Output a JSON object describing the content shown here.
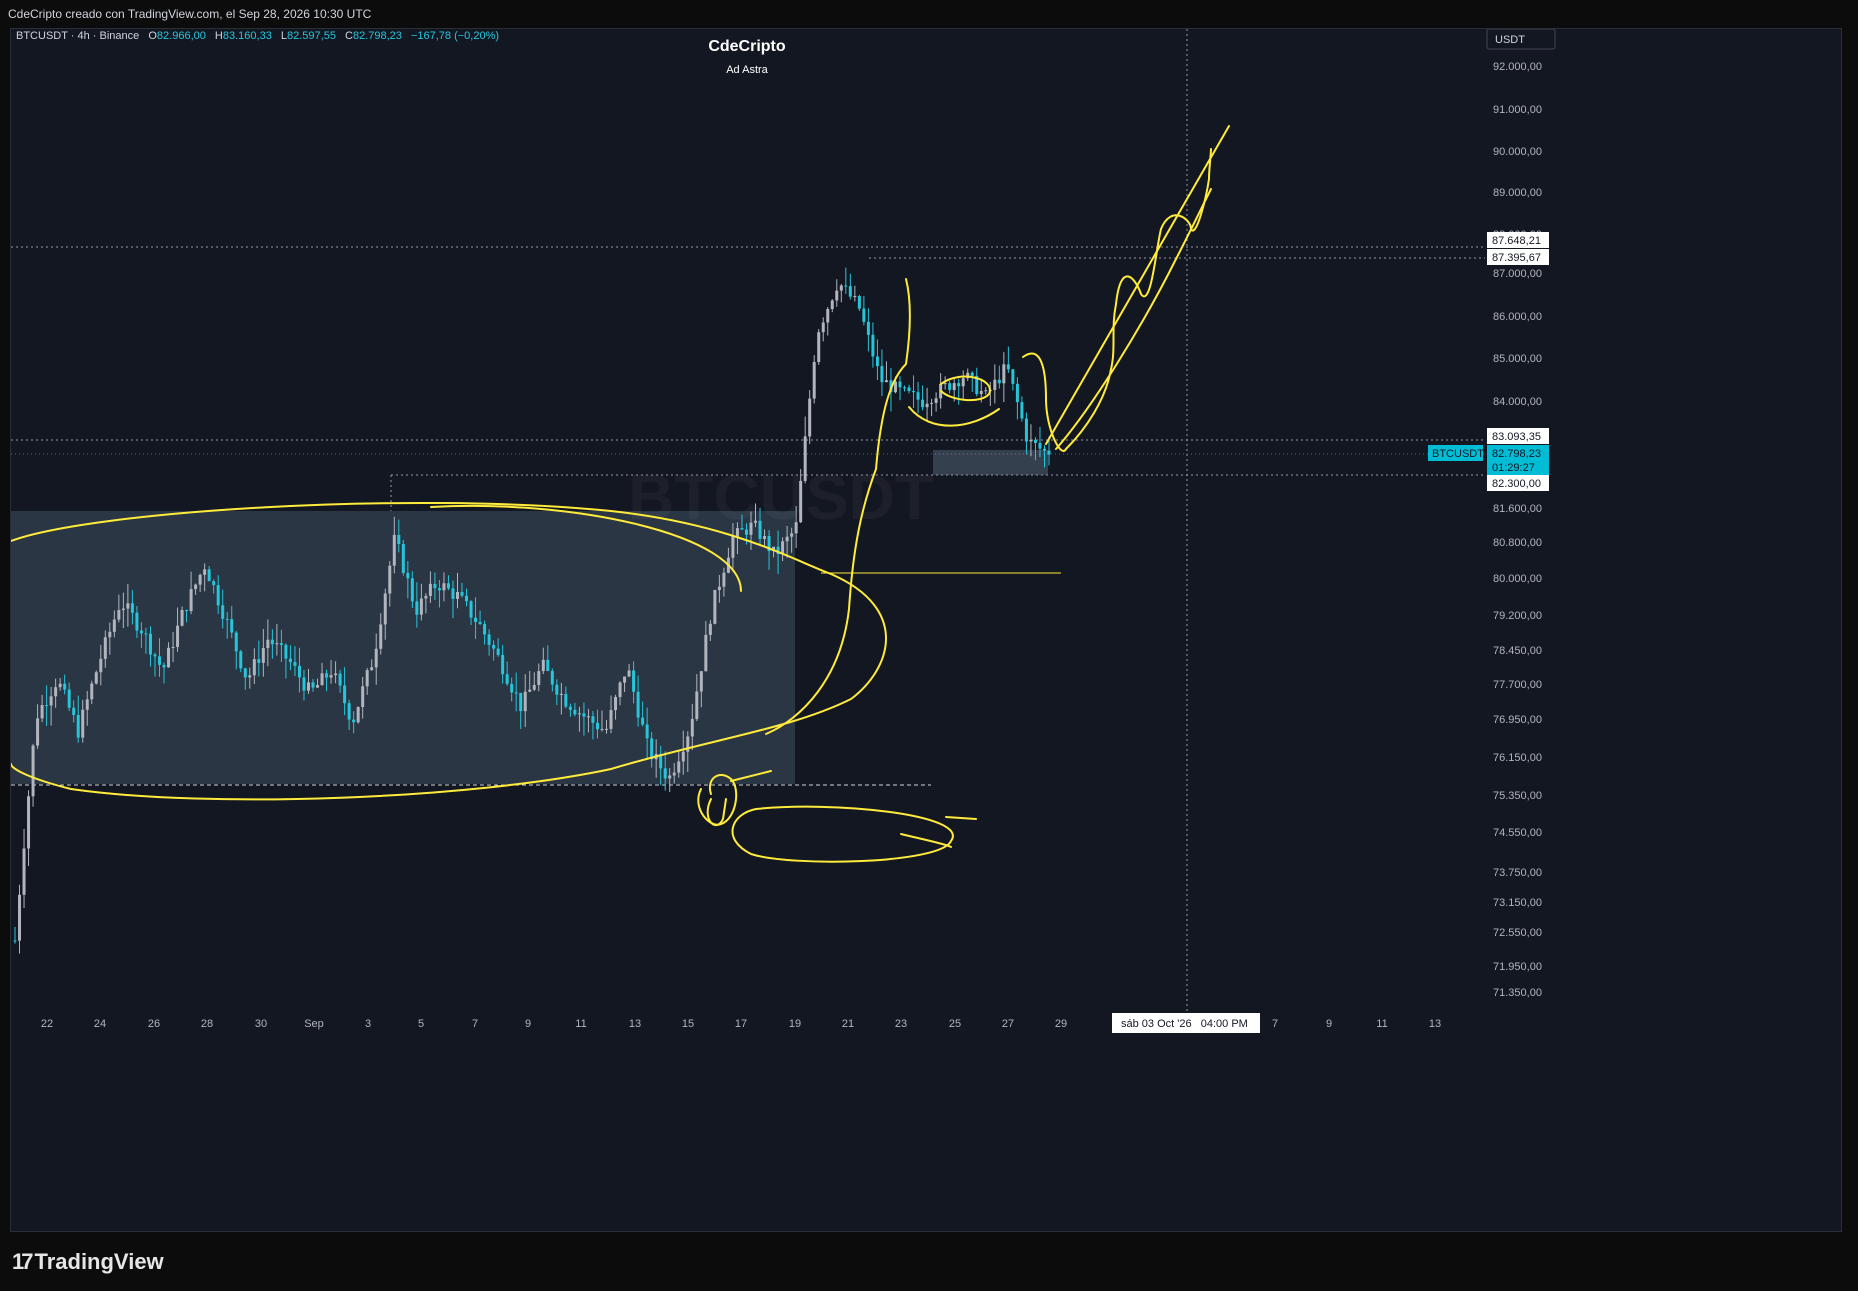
{
  "header": {
    "caption": "CdeCripto creado con TradingView.com, el Sep 28, 2026 10:30 UTC"
  },
  "symbol_info": {
    "label": "BTCUSDT · 4h · Binance",
    "o_label": "O",
    "o": "82.966,00",
    "h_label": "H",
    "h": "83.160,33",
    "l_label": "L",
    "l": "82.597,55",
    "c_label": "C",
    "c": "82.798,23",
    "change": "−167,78 (−0,20%)"
  },
  "chart_title": "CdeCripto",
  "chart_subtitle": "Ad Astra",
  "currency_button": "USDT",
  "watermark": "BTCUSDT",
  "price_labels": {
    "p1": "87.648,21",
    "p2": "87.395,67",
    "p3": "83.093,35",
    "p4": "82.798,23",
    "countdown": "01:29:27",
    "p5": "82.300,00",
    "ticker_tag": "BTCUSDT"
  },
  "crosshair_label": "sáb 03 Oct '26   04:00 PM",
  "brand": "TradingView",
  "colors": {
    "up": "#b2b5be",
    "down": "#26c6da",
    "annotation": "#ffeb3b",
    "background": "#131722",
    "last_price": "#00bcd4"
  },
  "chart_data": {
    "type": "candlestick",
    "symbol": "BTCUSDT",
    "interval": "4h",
    "exchange": "Binance",
    "y_axis": {
      "ticks": [
        {
          "v": 92000,
          "label": "92.000,00"
        },
        {
          "v": 91000,
          "label": "91.000,00"
        },
        {
          "v": 90000,
          "label": "90.000,00"
        },
        {
          "v": 89000,
          "label": "89.000,00"
        },
        {
          "v": 88000,
          "label": "88.000,00"
        },
        {
          "v": 87000,
          "label": "87.000,00"
        },
        {
          "v": 86000,
          "label": "86.000,00"
        },
        {
          "v": 85000,
          "label": "85.000,00"
        },
        {
          "v": 84000,
          "label": "84.000,00"
        },
        {
          "v": 81600,
          "label": "81.600,00"
        },
        {
          "v": 80800,
          "label": "80.800,00"
        },
        {
          "v": 80000,
          "label": "80.000,00"
        },
        {
          "v": 79200,
          "label": "79.200,00"
        },
        {
          "v": 78450,
          "label": "78.450,00"
        },
        {
          "v": 77700,
          "label": "77.700,00"
        },
        {
          "v": 76950,
          "label": "76.950,00"
        },
        {
          "v": 76150,
          "label": "76.150,00"
        },
        {
          "v": 75350,
          "label": "75.350,00"
        },
        {
          "v": 74550,
          "label": "74.550,00"
        },
        {
          "v": 73750,
          "label": "73.750,00"
        },
        {
          "v": 73150,
          "label": "73.150,00"
        },
        {
          "v": 72550,
          "label": "72.550,00"
        },
        {
          "v": 71950,
          "label": "71.950,00"
        },
        {
          "v": 71350,
          "label": "71.350,00"
        }
      ],
      "right_labels": [
        "87.648,21",
        "87.395,67",
        "83.093,35",
        "82.798,23",
        "82.300,00"
      ]
    },
    "x_axis": {
      "ticks": [
        "22",
        "24",
        "26",
        "28",
        "30",
        "Sep",
        "3",
        "5",
        "7",
        "9",
        "11",
        "13",
        "15",
        "17",
        "19",
        "21",
        "23",
        "25",
        "27",
        "29",
        "7",
        "9",
        "11",
        "13"
      ],
      "crosshair": "sáb 03 Oct '26   04:00 PM"
    },
    "ohlc_last": {
      "open": 82966.0,
      "high": 83160.33,
      "low": 82597.55,
      "close": 82798.23
    },
    "horizontal_levels": [
      87648.21,
      87395.67,
      83093.35,
      82300.0,
      80100,
      75550
    ],
    "price_path": [
      [
        0,
        72400
      ],
      [
        1,
        77000
      ],
      [
        2,
        77800
      ],
      [
        3,
        76700
      ],
      [
        4,
        78200
      ],
      [
        5,
        79500
      ],
      [
        6,
        78900
      ],
      [
        7,
        78000
      ],
      [
        8,
        79300
      ],
      [
        9,
        80300
      ],
      [
        10,
        79100
      ],
      [
        11,
        77800
      ],
      [
        12,
        78700
      ],
      [
        13,
        78200
      ],
      [
        14,
        77500
      ],
      [
        15,
        78000
      ],
      [
        16,
        76900
      ],
      [
        17,
        78300
      ],
      [
        18,
        80900
      ],
      [
        19,
        79300
      ],
      [
        20,
        79900
      ],
      [
        21,
        79600
      ],
      [
        22,
        79000
      ],
      [
        23,
        78200
      ],
      [
        24,
        77200
      ],
      [
        25,
        78100
      ],
      [
        26,
        77400
      ],
      [
        27,
        77000
      ],
      [
        28,
        76700
      ],
      [
        29,
        78100
      ],
      [
        30,
        76300
      ],
      [
        31,
        75700
      ],
      [
        32,
        76800
      ],
      [
        33,
        79300
      ],
      [
        34,
        80900
      ],
      [
        35,
        81200
      ],
      [
        36,
        80500
      ],
      [
        37,
        81100
      ],
      [
        38,
        85600
      ],
      [
        39,
        86800
      ],
      [
        40,
        86200
      ],
      [
        41,
        84500
      ],
      [
        42,
        84200
      ],
      [
        43,
        84000
      ],
      [
        44,
        84300
      ],
      [
        45,
        84600
      ],
      [
        46,
        84100
      ],
      [
        47,
        84800
      ],
      [
        48,
        83100
      ],
      [
        49,
        82800
      ]
    ]
  }
}
